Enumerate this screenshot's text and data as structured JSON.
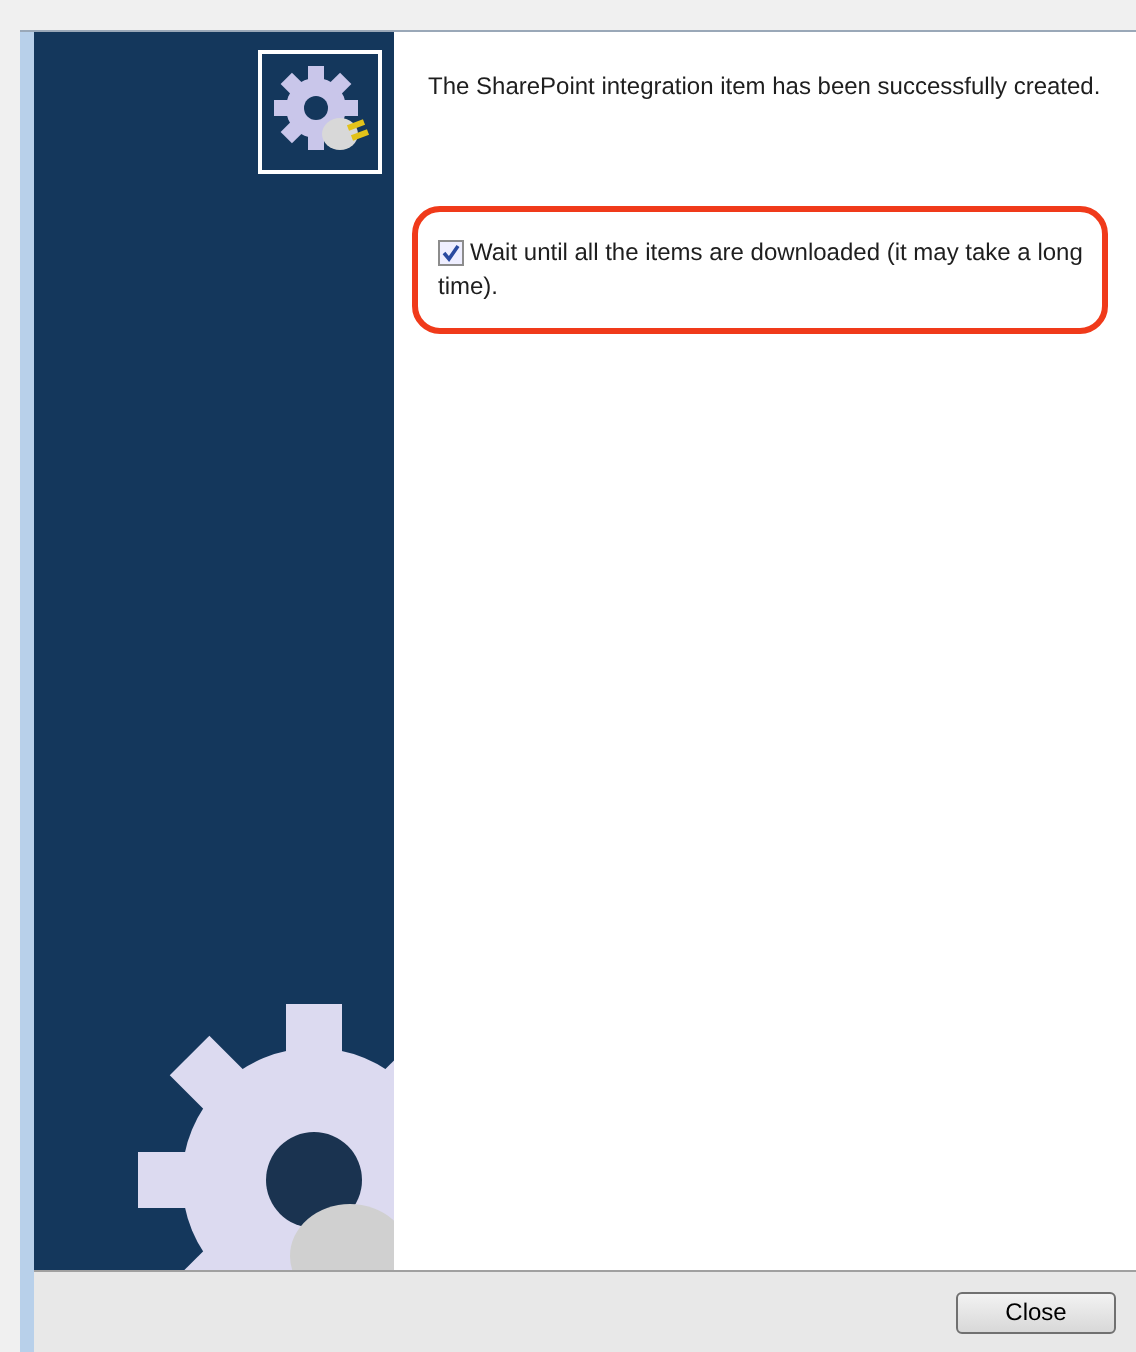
{
  "message": "The SharePoint integration item has been successfully created.",
  "option": {
    "label": "Wait until all the items are downloaded (it may take a long time).",
    "checked": true,
    "highlighted": true
  },
  "buttons": [
    {
      "label": "Close"
    }
  ]
}
